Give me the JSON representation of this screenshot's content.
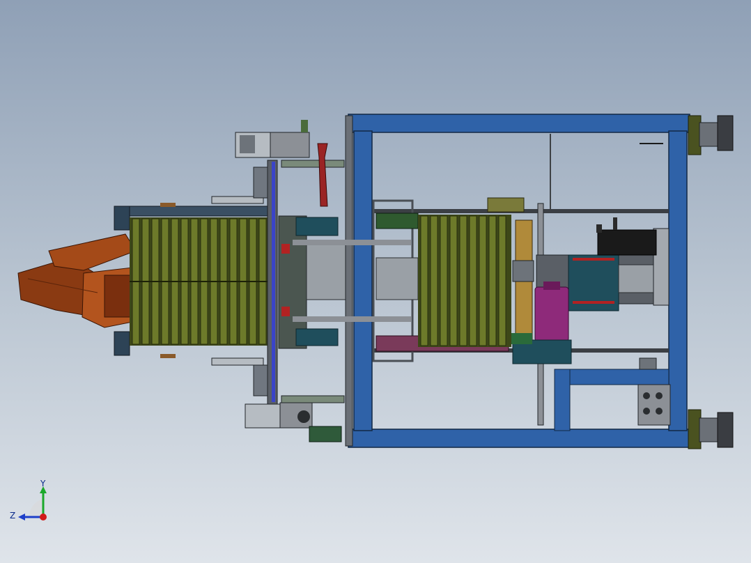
{
  "view": {
    "type": "cad-assembly-top-view",
    "background_top": "#8fa0b6",
    "background_bottom": "#dfe4ea"
  },
  "colors": {
    "frame_blue": "#2f62a8",
    "frame_blue_dark": "#1d4172",
    "comb_green": "#6d7a2a",
    "comb_green_dark": "#3d4718",
    "robot_orange": "#8a3a12",
    "robot_orange_light": "#b3541e",
    "motor_black": "#1a1a1a",
    "teal_block": "#1f4e5c",
    "magenta_part": "#8e2a7a",
    "steel_gray": "#8c9096",
    "axis_y": "#1aa82a",
    "axis_z": "#1d3fc9",
    "axis_origin": "#d01a1a"
  },
  "triad": {
    "y_label": "Y",
    "z_label": "Z"
  },
  "icons": {
    "robot_arm": "robot-arm-icon",
    "servo_motor": "servo-motor-icon",
    "caster_wheel": "caster-wheel-icon"
  }
}
